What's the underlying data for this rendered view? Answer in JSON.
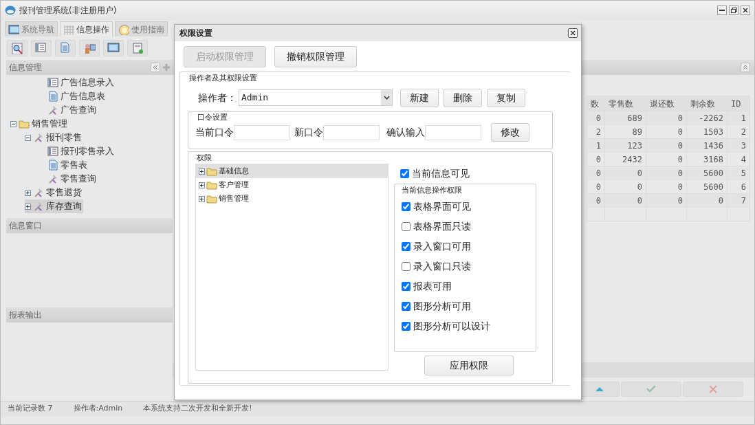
{
  "window": {
    "title": "报刊管理系统(非注册用户)"
  },
  "tabs": [
    {
      "label": "系统导航",
      "selected": false,
      "kind": "monitor"
    },
    {
      "label": "信息操作",
      "selected": true,
      "kind": "grid"
    },
    {
      "label": "使用指南",
      "selected": false,
      "kind": "help"
    }
  ],
  "toolbar": [
    {
      "kind": "search"
    },
    {
      "kind": "form"
    },
    {
      "kind": "doc"
    },
    {
      "kind": "user"
    },
    {
      "kind": "monitor"
    },
    {
      "kind": "add"
    }
  ],
  "left_panel": {
    "sections": [
      {
        "title": "信息管理",
        "tree": [
          {
            "children": [
              {
                "children": [
                  {
                    "label": "广告信息录入",
                    "kind": "form",
                    "selected": false
                  },
                  {
                    "label": "广告信息表",
                    "kind": "doc",
                    "selected": false
                  },
                  {
                    "label": "广告查询",
                    "kind": "tool",
                    "selected": false
                  }
                ]
              }
            ]
          },
          {
            "label": "销售管理",
            "kind": "folder",
            "expanded": true,
            "selected": false,
            "children": [
              {
                "label": "报刊零售",
                "kind": "tool",
                "expanded": true,
                "selected": false,
                "children": [
                  {
                    "label": "报刊零售录入",
                    "kind": "form",
                    "selected": false
                  },
                  {
                    "label": "零售表",
                    "kind": "doc",
                    "selected": false
                  },
                  {
                    "label": "零售查询",
                    "kind": "tool",
                    "selected": false
                  }
                ]
              },
              {
                "label": "零售退货",
                "kind": "tool",
                "expanded": false,
                "selected": false
              },
              {
                "label": "库存查询",
                "kind": "tool",
                "expanded": false,
                "selected": true
              }
            ]
          }
        ]
      },
      {
        "title": "信息窗口"
      },
      {
        "title": "报表输出"
      }
    ]
  },
  "table": {
    "columns": [
      "数",
      "零售数",
      "退还数",
      "剩余数",
      "ID"
    ],
    "rows": [
      [
        "0",
        "689",
        "0",
        "-2262",
        "1"
      ],
      [
        "2",
        "89",
        "0",
        "1503",
        "2"
      ],
      [
        "1",
        "123",
        "0",
        "1436",
        "3"
      ],
      [
        "0",
        "2432",
        "0",
        "3168",
        "4"
      ],
      [
        "0",
        "0",
        "0",
        "5600",
        "5"
      ],
      [
        "0",
        "0",
        "0",
        "5600",
        "6"
      ],
      [
        "0",
        "0",
        "0",
        "0",
        "7"
      ]
    ]
  },
  "bottom_buttons": [
    {
      "kind": "up"
    },
    {
      "kind": "ok"
    },
    {
      "kind": "cancel"
    }
  ],
  "status_bar": [
    "当前记录数 7",
    "操作者:Admin",
    "本系统支持二次开发和全新开发!"
  ],
  "dialog": {
    "title": "权限设置",
    "top_buttons": [
      {
        "label": "启动权限管理",
        "disabled": true
      },
      {
        "label": "撤销权限管理",
        "disabled": false
      }
    ],
    "operator_group": {
      "title": "操作者及其权限设置",
      "label": "操作者：",
      "value": "Admin",
      "buttons": [
        "新建",
        "删除",
        "复制"
      ]
    },
    "password_group": {
      "title": "口令设置",
      "fields": [
        {
          "label": "当前口令"
        },
        {
          "label": "新口令"
        },
        {
          "label": "确认输入"
        }
      ],
      "button": "修改"
    },
    "permission_group": {
      "title": "权限",
      "tree": [
        {
          "label": "基础信息",
          "expanded": false,
          "selected": true
        },
        {
          "label": "客户管理",
          "expanded": false,
          "selected": false
        },
        {
          "label": "销售管理",
          "expanded": false,
          "selected": false
        }
      ],
      "visible_check": {
        "label": "当前信息可见",
        "checked": true
      },
      "ops_group": {
        "title": "当前信息操作权限",
        "options": [
          {
            "label": "表格界面可见",
            "checked": true
          },
          {
            "label": "表格界面只读",
            "checked": false
          },
          {
            "label": "录入窗口可用",
            "checked": true
          },
          {
            "label": "录入窗口只读",
            "checked": false
          },
          {
            "label": "报表可用",
            "checked": true
          },
          {
            "label": "图形分析可用",
            "checked": true
          },
          {
            "label": "图形分析可以设计",
            "checked": true
          }
        ]
      },
      "apply_button": "应用权限"
    }
  }
}
